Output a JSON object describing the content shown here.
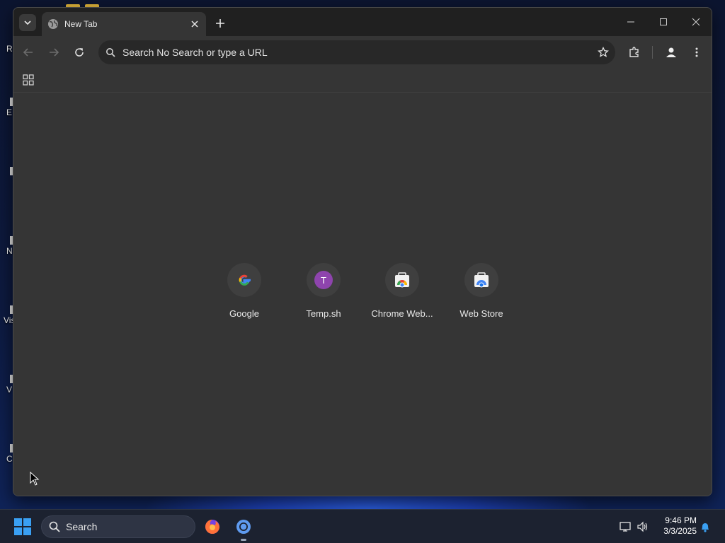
{
  "desktop": {
    "icons": [
      {
        "caption": "R"
      },
      {
        "caption": "E"
      },
      {
        "caption": ""
      },
      {
        "caption": "N"
      },
      {
        "caption": "Vis"
      },
      {
        "caption": "V"
      },
      {
        "caption": "C"
      }
    ]
  },
  "browser": {
    "tab": {
      "title": "New Tab",
      "favicon": "globe-icon"
    },
    "omnibox": {
      "text": "Search No Search or type a URL"
    },
    "shortcuts": [
      {
        "label": "Google",
        "icon": "google-icon"
      },
      {
        "label": "Temp.sh",
        "icon": "letter-avatar-icon",
        "letter": "T",
        "color": "#8e44ad"
      },
      {
        "label": "Chrome Web...",
        "icon": "chrome-web-store-icon"
      },
      {
        "label": "Web Store",
        "icon": "web-store-icon"
      }
    ]
  },
  "taskbar": {
    "search_label": "Search",
    "apps": [
      "firefox-icon",
      "chrome-icon"
    ],
    "clock": {
      "time": "9:46 PM",
      "date": "3/3/2025"
    }
  },
  "colors": {
    "window_bg": "#353535",
    "titlebar_bg": "#202020",
    "omnibox_bg": "#282828",
    "taskbar_bg": "#1c2230",
    "accent_blue": "#3aa0f3"
  }
}
